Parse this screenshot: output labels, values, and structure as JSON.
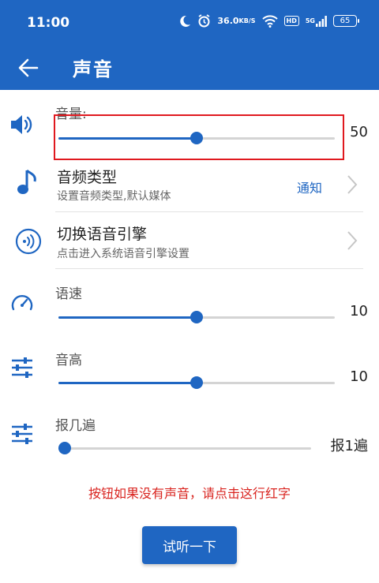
{
  "status_bar": {
    "time": "11:00",
    "net_speed_value": "36.0",
    "net_speed_unit": "KB/S",
    "hd_badge": "HD",
    "signal_label": "5G",
    "battery": "65"
  },
  "app_bar": {
    "title": "声音"
  },
  "volume": {
    "label": "音量:",
    "value": "50",
    "level": 0.5
  },
  "audio_type": {
    "title": "音频类型",
    "subtitle": "设置音频类型,默认媒体",
    "value": "通知"
  },
  "tts_engine": {
    "title": "切换语音引擎",
    "subtitle": "点击进入系统语音引擎设置"
  },
  "speech_rate": {
    "label": "语速",
    "value": "10",
    "level": 0.5
  },
  "pitch": {
    "label": "音高",
    "value": "10",
    "level": 0.5
  },
  "repeat": {
    "label": "报几遍",
    "value": "报1遍",
    "level": 0.0
  },
  "hint_text": "按钮如果没有声音，请点击这行红字",
  "listen_button_label": "试听一下",
  "colors": {
    "primary": "#1f66c2",
    "highlight": "#e0191f",
    "hint": "#d9241f"
  }
}
